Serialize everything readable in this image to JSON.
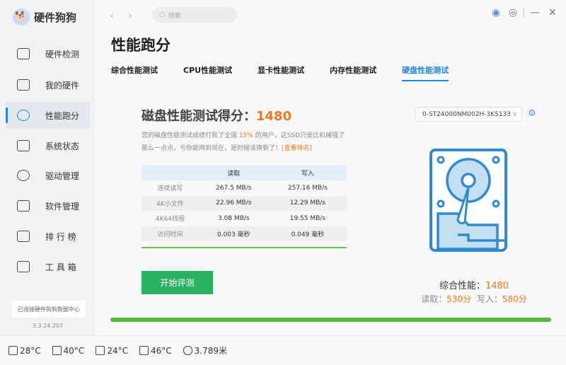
{
  "app": {
    "title": "硬件狗狗",
    "version": "3.3.24.207",
    "connection": "已连接硬件狗狗数据中心"
  },
  "sidebar": {
    "items": [
      {
        "label": "硬件检测"
      },
      {
        "label": "我的硬件"
      },
      {
        "label": "性能跑分"
      },
      {
        "label": "系统状态"
      },
      {
        "label": "驱动管理"
      },
      {
        "label": "软件管理"
      },
      {
        "label": "排 行 榜"
      },
      {
        "label": "工 具 箱"
      }
    ]
  },
  "search": {
    "placeholder": "搜索"
  },
  "page": {
    "title": "性能跑分"
  },
  "tabs": [
    {
      "label": "综合性能测试"
    },
    {
      "label": "CPU性能测试"
    },
    {
      "label": "显卡性能测试"
    },
    {
      "label": "内存性能测试"
    },
    {
      "label": "硬盘性能测试"
    }
  ],
  "result": {
    "label": "磁盘性能测试得分：",
    "score": "1480",
    "desc_a": "您的磁盘性能测试成绩打败了全国 ",
    "percent": "15%",
    "desc_b": " 的用户，这SSD只是比机械强了那么一点点，亏你能用到现在，是时候该换新了！",
    "rank_link": "[查看排名]"
  },
  "table": {
    "headers": [
      "",
      "读取",
      "写入"
    ],
    "rows": [
      [
        "连续读写",
        "267.5 MB/s",
        "257.16 MB/s"
      ],
      [
        "4K小文件",
        "22.96 MB/s",
        "12.29 MB/s"
      ],
      [
        "4K64线程",
        "3.08 MB/s",
        "19.55 MB/s"
      ],
      [
        "访问时间",
        "0.003 毫秒",
        "0.049 毫秒"
      ]
    ]
  },
  "start_button": "开始评测",
  "device": {
    "selected": "0-ST24000NM002H-3KS133"
  },
  "summary": {
    "total_label": "综合性能：",
    "total": "1480",
    "read_label": "读取：",
    "read": "530分",
    "write_label": "写入：",
    "write": "580分"
  },
  "progress": 1.0,
  "statusbar": {
    "cpu_temp": "28°C",
    "board_temp": "40°C",
    "gpu_temp": "24°C",
    "disk_temp": "46°C",
    "mouse_distance": "3.789米"
  },
  "colors": {
    "accent": "#1e88e5",
    "score": "#f4761d",
    "green": "#27b35f"
  }
}
